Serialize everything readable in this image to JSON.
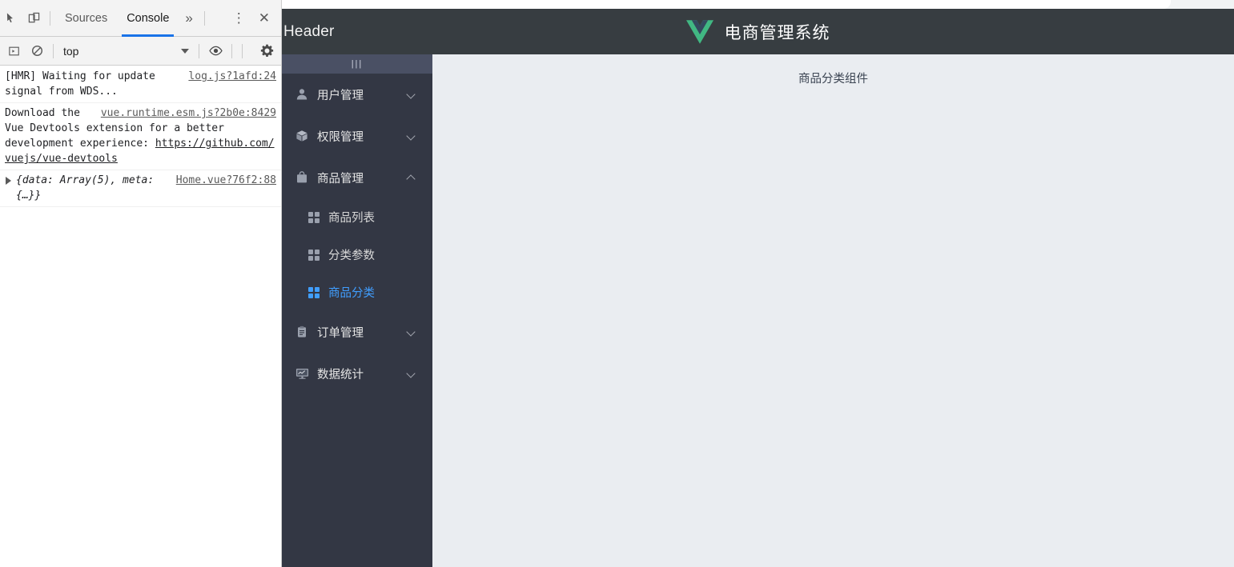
{
  "devtools": {
    "tabs": [
      {
        "label": "Sources",
        "active": false
      },
      {
        "label": "Console",
        "active": true
      }
    ],
    "more_label": "»",
    "kebab_label": "⋮",
    "close_label": "✕",
    "context": {
      "value": "top"
    },
    "console_logs": [
      {
        "source": "log.js?1afd:24",
        "text": "[HMR] Waiting for update signal from WDS...",
        "type": "text"
      },
      {
        "source": "vue.runtime.esm.js?2b0e:8429",
        "text": "Download the Vue Devtools extension for a better development experience:",
        "link": "https://github.com/vuejs/vue-devtools",
        "type": "link"
      },
      {
        "source": "Home.vue?76f2:88",
        "text": "{data: Array(5), meta: {…}}",
        "type": "object"
      }
    ]
  },
  "app": {
    "header": {
      "left_text": "Header",
      "brand_title": "电商管理系统",
      "logo_name": "vue-logo"
    },
    "sidebar": {
      "toggle_label": "|||",
      "groups": [
        {
          "id": "user",
          "label": "用户管理",
          "icon": "user-icon",
          "expanded": false,
          "children": []
        },
        {
          "id": "rights",
          "label": "权限管理",
          "icon": "box-icon",
          "expanded": false,
          "children": []
        },
        {
          "id": "goods",
          "label": "商品管理",
          "icon": "bag-icon",
          "expanded": true,
          "children": [
            {
              "id": "goods-list",
              "label": "商品列表",
              "active": false
            },
            {
              "id": "params",
              "label": "分类参数",
              "active": false
            },
            {
              "id": "categories",
              "label": "商品分类",
              "active": true
            }
          ]
        },
        {
          "id": "orders",
          "label": "订单管理",
          "icon": "clipboard-icon",
          "expanded": false,
          "children": []
        },
        {
          "id": "reports",
          "label": "数据统计",
          "icon": "monitor-chart-icon",
          "expanded": false,
          "children": []
        }
      ]
    },
    "main": {
      "title": "商品分类组件"
    }
  },
  "colors": {
    "header_bg": "#373d41",
    "sidebar_bg": "#333744",
    "toggle_bg": "#4a5064",
    "main_bg": "#eaedf1",
    "accent": "#409eff",
    "devtools_tab_underline": "#1a73e8"
  }
}
